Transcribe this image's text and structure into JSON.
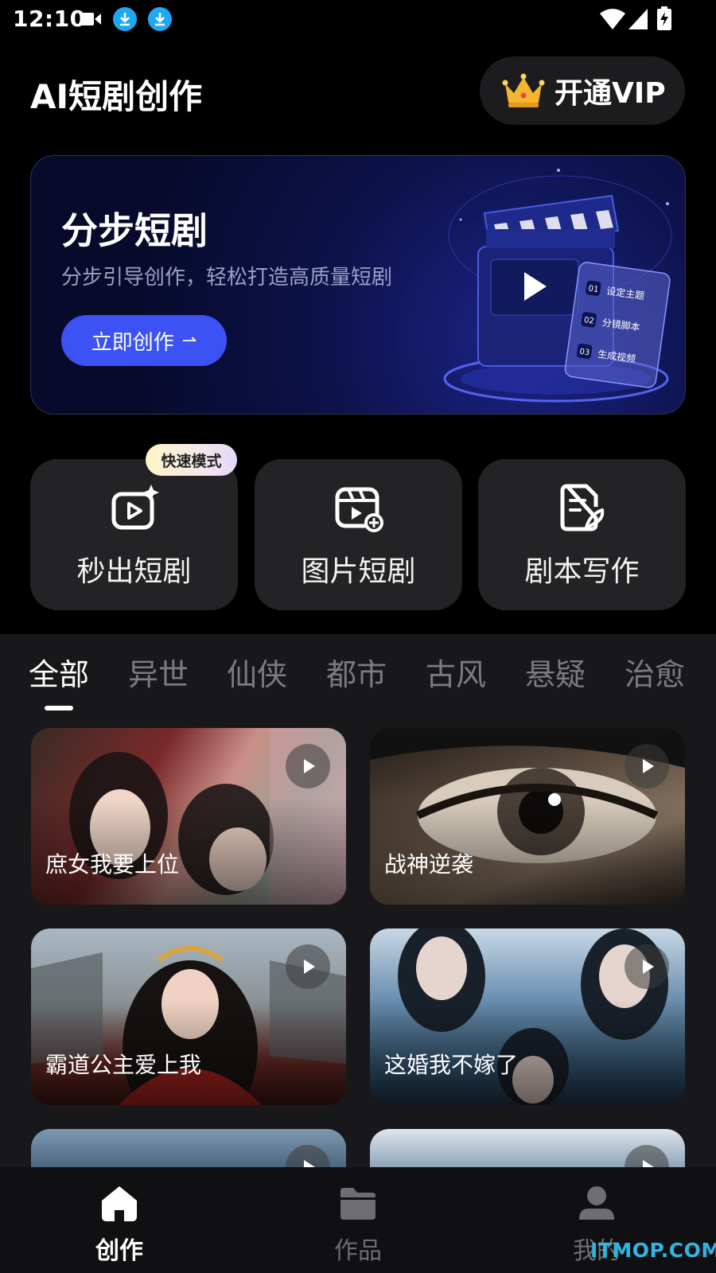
{
  "status_bar": {
    "time": "12:10"
  },
  "header": {
    "title": "AI短剧创作",
    "vip_label": "开通VIP"
  },
  "banner": {
    "title": "分步短剧",
    "subtitle": "分步引导创作，轻松打造高质量短剧",
    "cta_label": "立即创作",
    "cta_arrow": "⇀",
    "steps": [
      {
        "num": "01",
        "label": "设定主题"
      },
      {
        "num": "02",
        "label": "分镜脚本"
      },
      {
        "num": "03",
        "label": "生成视频"
      }
    ]
  },
  "features": [
    {
      "label": "秒出短剧",
      "badge": "快速模式",
      "icon": "video-sparkle-icon"
    },
    {
      "label": "图片短剧",
      "icon": "image-film-icon"
    },
    {
      "label": "剧本写作",
      "icon": "script-pen-icon"
    }
  ],
  "tabs": [
    "全部",
    "异世",
    "仙侠",
    "都市",
    "古风",
    "悬疑",
    "治愈"
  ],
  "active_tab": "全部",
  "cards": [
    {
      "title": "庶女我要上位"
    },
    {
      "title": "战神逆袭"
    },
    {
      "title": "霸道公主爱上我"
    },
    {
      "title": "这婚我不嫁了"
    }
  ],
  "bottom_nav": [
    {
      "label": "创作",
      "icon": "home-icon",
      "active": true
    },
    {
      "label": "作品",
      "icon": "folder-icon",
      "active": false
    },
    {
      "label": "我的",
      "icon": "profile-icon",
      "active": false
    }
  ],
  "watermark": "ITMOP.COM",
  "colors": {
    "accent": "#3d52f5",
    "background": "#000000",
    "panel": "#18181a",
    "card": "#232325"
  }
}
